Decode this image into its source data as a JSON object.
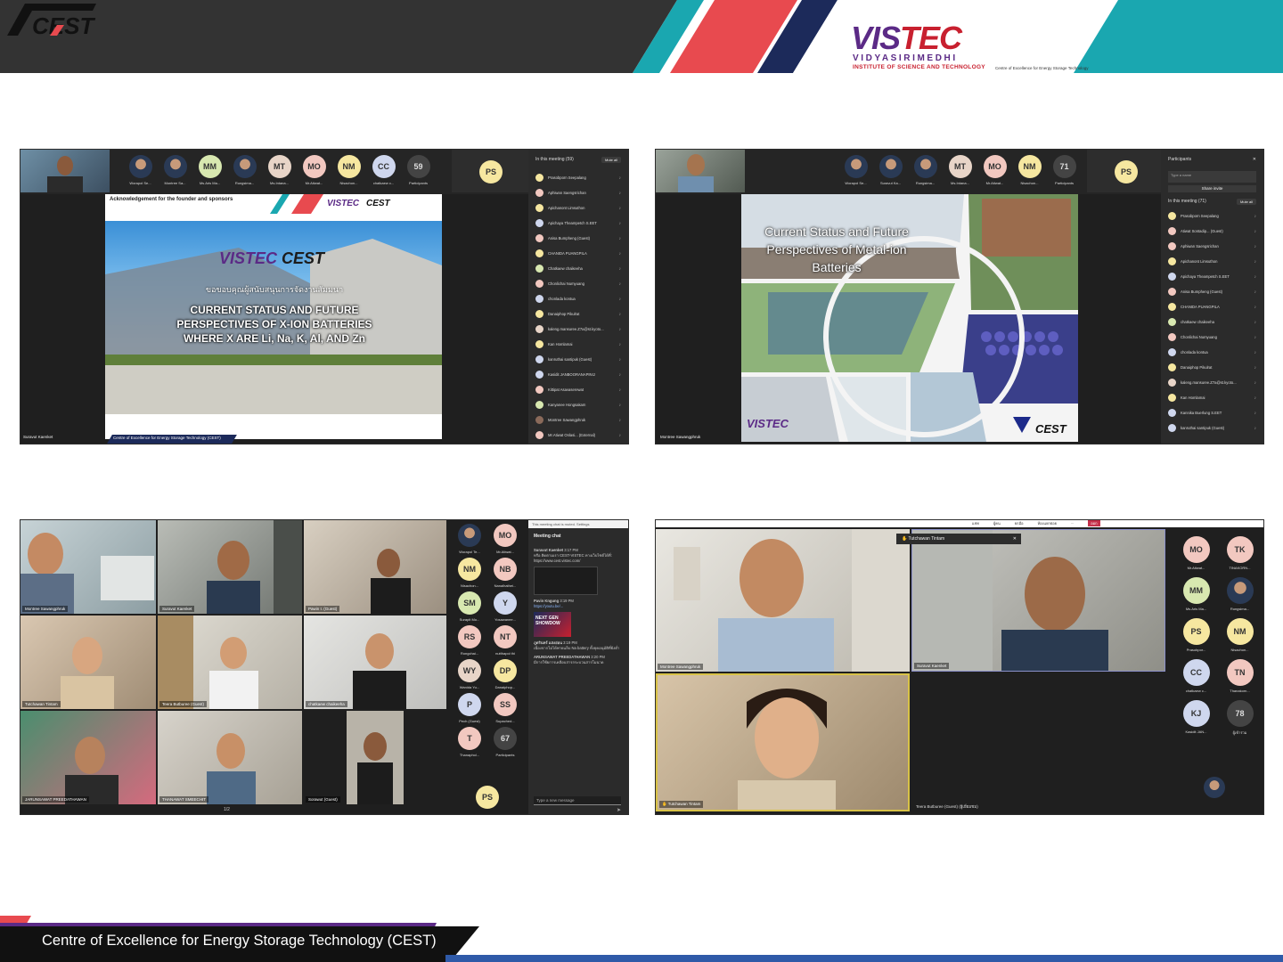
{
  "header": {
    "logo_vis": "VIS",
    "logo_tec": "TEC",
    "logo_sub1": "VIDYASIRIMEDHI",
    "logo_sub2": "INSTITUTE OF SCIENCE AND TECHNOLOGY",
    "cest_mark": "CEST",
    "cest_sub": "Centre of Excellence for Energy Storage Technology"
  },
  "footer": {
    "text": "Centre of Excellence for Energy Storage Technology (CEST)"
  },
  "colors": {
    "dark": "#333333",
    "teal": "#1aa7b0",
    "red": "#e84a4f",
    "purple": "#5b2a86",
    "navy": "#1c2a5a"
  },
  "panel1": {
    "strip_people": [
      {
        "initials": "",
        "name": "Worapol Se..."
      },
      {
        "initials": "",
        "name": "Montree Sa..."
      },
      {
        "initials": "MM",
        "name": "Ms.Aris Ma..."
      },
      {
        "initials": "",
        "name": "Rungsima..."
      },
      {
        "initials": "MT",
        "name": "Ms.Intana..."
      },
      {
        "initials": "MO",
        "name": "Mr.Atiwat..."
      },
      {
        "initials": "NM",
        "name": "Nisachon..."
      },
      {
        "initials": "CC",
        "name": "chatkaew c..."
      },
      {
        "initials": "59",
        "name": "Participants"
      }
    ],
    "self_initials": "PS",
    "sidebar_title": "In this meeting (59)",
    "mute_all": "Mute all",
    "participants": [
      "Prasobporn Seepalang",
      "Aphiwan Saengsrichan",
      "Apichanont Limsuthon",
      "Apichaya Theampetch S.EET",
      "Anisa Bumpheng (Guest)",
      "CHANIDA PUANGPILA",
      "Chatkaew chaikeeha",
      "Chonlichai Numyuang",
      "chonlada kontua",
      "Danaiphop Pikulrat",
      "kaleng.mansuree.Z7a@st.kyoto...",
      "Kan Homlamai",
      "kanruthai santipuk (Guest)",
      "Kasidit JANBOORANAPINIJ",
      "Kittipat Asavaserewat",
      "Kanyanee Hongsakam",
      "Montree Sawangphruk",
      "Mr.Atiwat Onlasi... (External)"
    ],
    "slide_header": "Acknowledgement for the founder and sponsors",
    "slide_logo": "VISTEC",
    "slide_logo2": "CEST",
    "slide_thai": "ขอขอบคุณผู้สนับสนุนการจัดงานสัมมนา",
    "slide_title_1": "CURRENT STATUS AND FUTURE",
    "slide_title_2": "PERSPECTIVES OF X-ION BATTERIES",
    "slide_title_3": "WHERE X ARE Li, Na, K, Al, AND Zn",
    "presenter": "Suravut Kaenket",
    "slide_footer": "Centre of Excellence for Energy Storage Technology (CEST)"
  },
  "panel2": {
    "strip_people": [
      {
        "initials": "",
        "name": "Worapol Se..."
      },
      {
        "initials": "",
        "name": "Suravut Ka..."
      },
      {
        "initials": "",
        "name": "Rungsima..."
      },
      {
        "initials": "MT",
        "name": "Ms.Intana..."
      },
      {
        "initials": "MO",
        "name": "Mr.Atiwat..."
      },
      {
        "initials": "NM",
        "name": "Nisachon..."
      },
      {
        "initials": "71",
        "name": "Participants"
      }
    ],
    "self_initials": "PS",
    "sidebar_title": "Participants",
    "search_placeholder": "Type a name",
    "share_invite": "Share invite",
    "in_meeting": "In this meeting (71)",
    "mute_all": "Mute all",
    "participants": [
      "Prasobporn Seepalang",
      "Atiwat Sontadip... (Guest)",
      "Aphiwan Saengsrichan",
      "Apichanont Limsuthon",
      "Apichaya Theampetch S.EET",
      "Anisa Bumpheng (Guest)",
      "CHANIDA PUANGPILA",
      "chatkaew chaikeeha",
      "Chonlichai Numyuang",
      "chonlada kontua",
      "Danaiphop Pikulrat",
      "kaleng.mansuree.Z7a@st.kyoto...",
      "Kan Homlamai",
      "Kannika Buerlung S.EET",
      "kanruthai santipuk (Guest)"
    ],
    "slide_title": "Current Status and Future Perspectives of Metal-ion Batteries",
    "slide_logo": "VISTEC",
    "slide_logo2": "CEST",
    "presenter": "Montree Sawangphruk"
  },
  "panel3": {
    "tiles": [
      "Montree Sawangphruk",
      "Suravut Kaenket",
      "Pawin I. (Guest)",
      "Tutchawan Tintam",
      "Teera Butburee (Guest)",
      "chatkaew chaikeeha",
      "JARUNSAWAT PREEDATHAWAN",
      "THANAWAT SMEECHIT",
      "Sorawut (Guest)"
    ],
    "pager": "1/2",
    "side_people": [
      {
        "initials": "",
        "name": "Worapol Te..."
      },
      {
        "initials": "MO",
        "name": "Mr.Atiwat..."
      },
      {
        "initials": "NM",
        "name": "Nisachon..."
      },
      {
        "initials": "NB",
        "name": "Nanalhathei..."
      },
      {
        "initials": "SM",
        "name": "Surapit Mo..."
      },
      {
        "initials": "Y",
        "name": "Yosawanee..."
      },
      {
        "initials": "RS",
        "name": "Rongchai..."
      },
      {
        "initials": "NT",
        "name": "nutthapol thi"
      },
      {
        "initials": "WY",
        "name": "Wanida Yu..."
      },
      {
        "initials": "DP",
        "name": "Danaiphop..."
      },
      {
        "initials": "P",
        "name": "Pech (Guest)"
      },
      {
        "initials": "SS",
        "name": "Supached..."
      },
      {
        "initials": "T",
        "name": "Thanaphol..."
      },
      {
        "initials": "67",
        "name": "Participants"
      }
    ],
    "self_initials": "PS",
    "chat_notice": "This meeting chat is muted. Settings",
    "chat_title": "Meeting chat",
    "messages": [
      {
        "author": "Suravut Kaenket",
        "time": "3:17 PM",
        "text": "หรือ ติดตามเรา CEST-VISTEC ทางเว็บไซต์ได้ที่: https://www.cest.vistec.com/"
      },
      {
        "author": "Pavin Kngung",
        "time": "3:19 PM",
        "text": "https://youtu.be/..."
      },
      {
        "author": "ภูดรินทร์ แสงอ่อน",
        "time": "3:19 PM",
        "text": "เนื่องจากไม่ได้พายแล็บ Na battery ทั้งยุคอนุมัติที่ยังต่ำ"
      },
      {
        "author": "ARUNSAWAT PREEDATHAWAN",
        "time": "3:20 PM",
        "text": "มีการใช้ยการเคลือบสารกระบวนสารโมนาด"
      }
    ],
    "video_card": "NEXT GEN SHOWDOW",
    "compose_placeholder": "Type a new message"
  },
  "panel4": {
    "menu": [
      "แชท",
      "ผู้คน",
      "ยกมือ",
      "ห้องแยกย่อย",
      "...",
      "ออก"
    ],
    "tiles": [
      "Montree Sawangphruk",
      "Suravut Kaenket",
      "Tutchawan Tintam"
    ],
    "popup_name": "Tutchawan Tintam",
    "bottom_caption": "Teera Butburee (Guest) (ผู้เยี่ยมชม)",
    "side_people": [
      {
        "initials": "MO",
        "name": "Mr.Atiwat..."
      },
      {
        "initials": "TK",
        "name": "TINAKORN..."
      },
      {
        "initials": "MM",
        "name": "Ms.Aris Ma..."
      },
      {
        "initials": "",
        "name": "Rungsima..."
      },
      {
        "initials": "PS",
        "name": "Prasobpor..."
      },
      {
        "initials": "NM",
        "name": "Nisachon..."
      },
      {
        "initials": "CC",
        "name": "chatkaew c..."
      },
      {
        "initials": "TN",
        "name": "Thanakorn..."
      },
      {
        "initials": "KJ",
        "name": "Kasidit JAN..."
      },
      {
        "initials": "78",
        "name": "ผู้เข้าร่วม"
      }
    ]
  }
}
